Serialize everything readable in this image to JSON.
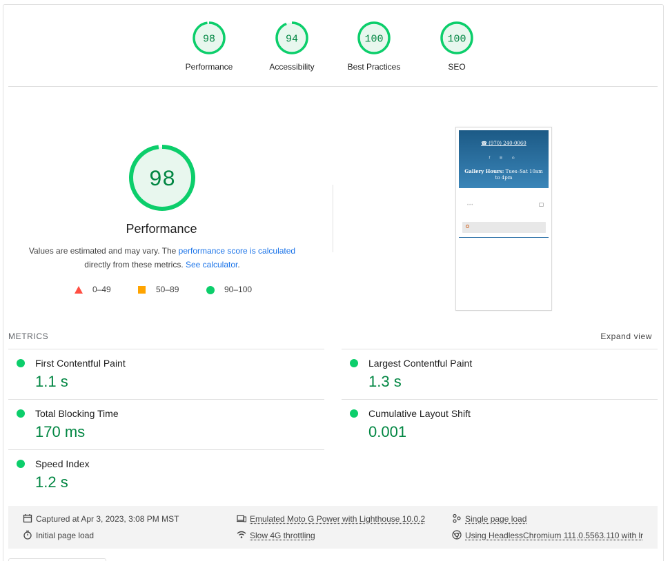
{
  "scores": [
    {
      "label": "Performance",
      "value": "98",
      "fraction": 0.98
    },
    {
      "label": "Accessibility",
      "value": "94",
      "fraction": 0.94
    },
    {
      "label": "Best Practices",
      "value": "100",
      "fraction": 1.0
    },
    {
      "label": "SEO",
      "value": "100",
      "fraction": 1.0
    }
  ],
  "colors": {
    "pass": "#0cce6b",
    "pass_fill": "#e8f7ee",
    "pass_text": "#018642",
    "average": "#ffa400",
    "fail": "#ff4e42",
    "link": "#1a73e8"
  },
  "performance": {
    "score": "98",
    "fraction": 0.98,
    "title": "Performance",
    "desc_prefix": "Values are estimated and may vary. The ",
    "desc_link1": "performance score is calculated",
    "desc_middle": "directly from these metrics. ",
    "desc_link2": "See calculator",
    "desc_suffix": "."
  },
  "legend": [
    {
      "shape": "triangle",
      "label": "0–49"
    },
    {
      "shape": "square",
      "label": "50–89"
    },
    {
      "shape": "circle",
      "label": "90–100"
    }
  ],
  "thumbnail": {
    "phone": "(970) 240-0060",
    "socials": "f ◎ ⌂",
    "hours_bold": "Gallery Hours:",
    "hours_text": " Tues–Sat 10am to 4pm",
    "dots": "•••"
  },
  "metrics": {
    "header": "METRICS",
    "expand": "Expand view",
    "items": [
      {
        "name": "First Contentful Paint",
        "value": "1.1 s"
      },
      {
        "name": "Largest Contentful Paint",
        "value": "1.3 s"
      },
      {
        "name": "Total Blocking Time",
        "value": "170 ms"
      },
      {
        "name": "Cumulative Layout Shift",
        "value": "0.001"
      },
      {
        "name": "Speed Index",
        "value": "1.2 s"
      }
    ]
  },
  "footer": {
    "captured": "Captured at Apr 3, 2023, 3:08 PM MST",
    "initial": "Initial page load",
    "emulated": "Emulated Moto G Power with Lighthouse 10.0.2",
    "throttling": "Slow 4G throttling",
    "single": "Single page load",
    "using": "Using HeadlessChromium 111.0.5563.110 with lr"
  }
}
